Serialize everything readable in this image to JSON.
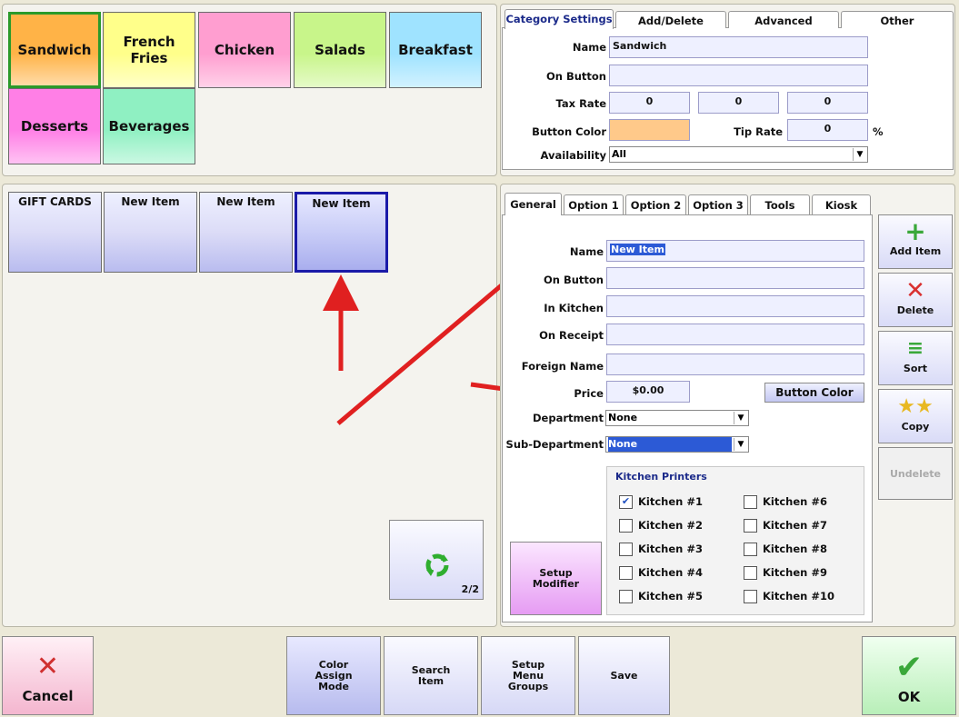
{
  "categories": [
    {
      "label": "Sandwich",
      "color": "#ffb347",
      "selected": true
    },
    {
      "label": "French Fries",
      "color": "#ffff8a"
    },
    {
      "label": "Chicken",
      "color": "#ff9ed0"
    },
    {
      "label": "Salads",
      "color": "#c8f58a"
    },
    {
      "label": "Breakfast",
      "color": "#9fe3ff"
    },
    {
      "label": "Desserts",
      "color": "#ff7fe6"
    },
    {
      "label": "Beverages",
      "color": "#8ff0c2"
    }
  ],
  "category_tabs": [
    "Category Settings",
    "Add/Delete",
    "Advanced",
    "Other"
  ],
  "category_settings": {
    "name_label": "Name",
    "name_value": "Sandwich",
    "on_button_label": "On Button",
    "on_button_value": "",
    "tax_rate_label": "Tax Rate",
    "tax_rates": [
      "0",
      "0",
      "0"
    ],
    "button_color_label": "Button Color",
    "button_color": "#ffc98a",
    "tip_rate_label": "Tip Rate",
    "tip_rate_value": "0",
    "tip_unit": "%",
    "availability_label": "Availability",
    "availability_value": "All"
  },
  "items": [
    {
      "label": "GIFT CARDS"
    },
    {
      "label": "New Item"
    },
    {
      "label": "New Item"
    },
    {
      "label": "New Item",
      "selected": true
    }
  ],
  "item_tabs": [
    "General",
    "Option 1",
    "Option 2",
    "Option 3",
    "Tools",
    "Kiosk"
  ],
  "general": {
    "name_label": "Name",
    "name_value": "New Item",
    "on_button_label": "On Button",
    "in_kitchen_label": "In Kitchen",
    "on_receipt_label": "On Receipt",
    "foreign_name_label": "Foreign Name",
    "price_label": "Price",
    "price_value": "$0.00",
    "button_color_label": "Button Color",
    "department_label": "Department",
    "department_value": "None",
    "subdepartment_label": "Sub-Department",
    "subdepartment_value": "None",
    "kitchen_printers_title": "Kitchen Printers",
    "printers": [
      {
        "label": "Kitchen #1",
        "checked": true
      },
      {
        "label": "Kitchen #2",
        "checked": false
      },
      {
        "label": "Kitchen #3",
        "checked": false
      },
      {
        "label": "Kitchen #4",
        "checked": false
      },
      {
        "label": "Kitchen #5",
        "checked": false
      },
      {
        "label": "Kitchen #6",
        "checked": false
      },
      {
        "label": "Kitchen #7",
        "checked": false
      },
      {
        "label": "Kitchen #8",
        "checked": false
      },
      {
        "label": "Kitchen #9",
        "checked": false
      },
      {
        "label": "Kitchen #10",
        "checked": false
      }
    ],
    "setup_modifier_label": "Setup Modifier"
  },
  "page_indicator": "2/2",
  "side_buttons": {
    "add_item": "Add Item",
    "delete": "Delete",
    "sort": "Sort",
    "copy": "Copy",
    "undelete": "Undelete"
  },
  "bottom": {
    "cancel": "Cancel",
    "color_assign": "Color Assign Mode",
    "search_item": "Search Item",
    "setup_menu_groups": "Setup Menu Groups",
    "save": "Save",
    "ok": "OK"
  }
}
